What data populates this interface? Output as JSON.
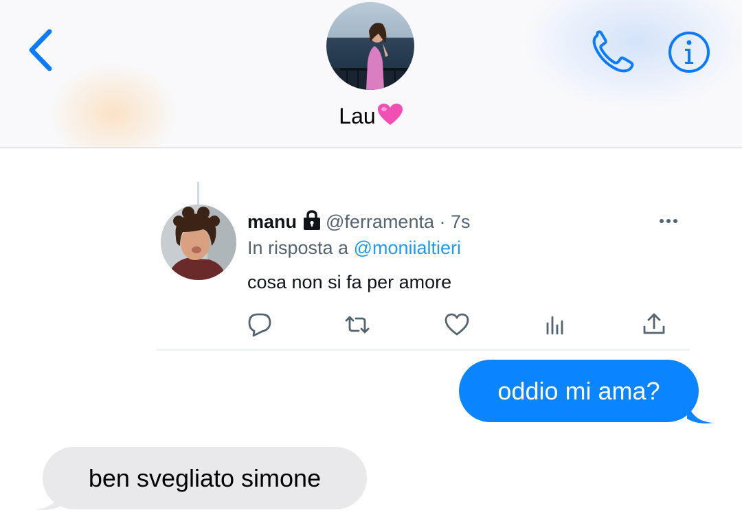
{
  "header": {
    "contact_name": "Lau",
    "heart_emoji": "pink-heart-icon"
  },
  "tweet": {
    "display_name": "manu",
    "handle": "@ferramenta",
    "separator": "·",
    "time": "7s",
    "reply_prefix": "In risposta a",
    "reply_mention": "@moniialtieri",
    "text": "cosa non si fa per amore"
  },
  "messages": {
    "outgoing": "oddio mi ama?",
    "incoming": "ben svegliato simone"
  },
  "colors": {
    "ios_blue": "#0b84ff",
    "twitter_blue": "#1d9bf0",
    "incoming_bubble": "#e9e9eb",
    "muted_text": "#536471"
  }
}
